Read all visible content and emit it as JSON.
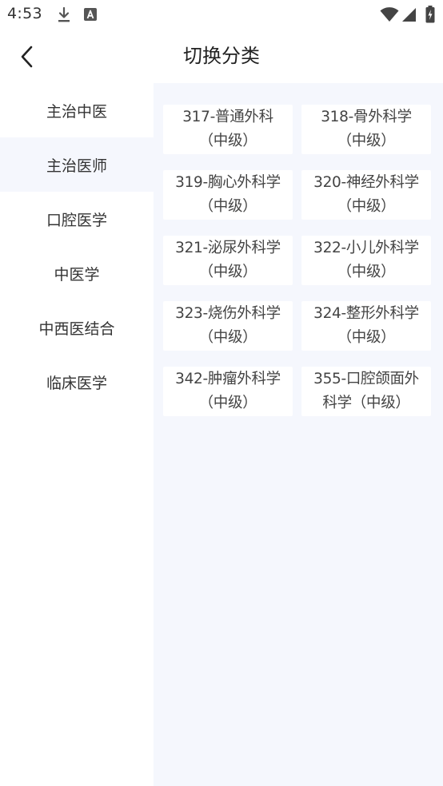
{
  "status_bar": {
    "time": "4:53",
    "icons": [
      "download-icon",
      "a-box-icon",
      "wifi-icon",
      "signal-icon",
      "battery-charging-icon"
    ]
  },
  "header": {
    "back_icon": "chevron-left-icon",
    "title": "切换分类"
  },
  "sidebar": {
    "items": [
      {
        "label": "主治中医",
        "active": false
      },
      {
        "label": "主治医师",
        "active": true
      },
      {
        "label": "口腔医学",
        "active": false
      },
      {
        "label": "中医学",
        "active": false
      },
      {
        "label": "中西医结合",
        "active": false
      },
      {
        "label": "临床医学",
        "active": false
      }
    ]
  },
  "content": {
    "cards": [
      {
        "label": "317-普通外科\n（中级）"
      },
      {
        "label": "318-骨外科学\n（中级）"
      },
      {
        "label": "319-胸心外科学\n（中级）"
      },
      {
        "label": "320-神经外科学\n（中级）"
      },
      {
        "label": "321-泌尿外科学\n（中级）"
      },
      {
        "label": "322-小儿外科学\n（中级）"
      },
      {
        "label": "323-烧伤外科学\n（中级）"
      },
      {
        "label": "324-整形外科学\n（中级）"
      },
      {
        "label": "342-肿瘤外科学\n（中级）"
      },
      {
        "label": "355-口腔颌面外\n科学（中级）"
      }
    ]
  },
  "colors": {
    "content_background": "#f5f7fd",
    "active_sidebar_background": "#f5f7fd",
    "text": "#333333"
  }
}
